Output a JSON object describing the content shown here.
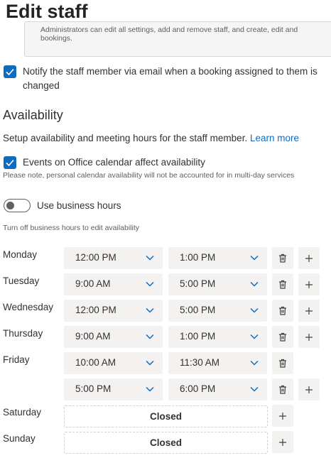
{
  "page": {
    "title": "Edit staff"
  },
  "role_info": {
    "text_line1": "Administrators can edit all settings, add and remove staff, and create, edit and",
    "text_line2": "bookings."
  },
  "notify": {
    "label_line1": "Notify the staff member via email when a booking assigned to them is",
    "label_line2": "changed",
    "checked": true
  },
  "availability": {
    "heading": "Availability",
    "description": "Setup availability and meeting hours for the staff member.",
    "learn_more": "Learn more",
    "events_label": "Events on Office calendar affect availability",
    "events_checked": true,
    "personal_note": "Please note, personal calendar availability will not be accounted for in multi-day services",
    "business_hours_label": "Use business hours",
    "business_hours_on": false,
    "business_hours_note": "Turn off business hours to edit availability"
  },
  "schedule": {
    "closed_label": "Closed",
    "monday": {
      "day": "Monday",
      "start": "12:00 PM",
      "end": "1:00 PM"
    },
    "tuesday": {
      "day": "Tuesday",
      "start": "9:00 AM",
      "end": "5:00 PM"
    },
    "wednesday": {
      "day": "Wednesday",
      "start": "12:00 PM",
      "end": "5:00 PM"
    },
    "thursday": {
      "day": "Thursday",
      "start": "9:00 AM",
      "end": "1:00 PM"
    },
    "friday": {
      "day": "Friday",
      "start": "10:00 AM",
      "end": "11:30 AM",
      "start2": "5:00 PM",
      "end2": "6:00 PM"
    },
    "saturday": {
      "day": "Saturday"
    },
    "sunday": {
      "day": "Sunday"
    }
  },
  "icons": {
    "delete": "trash-icon",
    "add": "plus-icon",
    "dropdown": "chevron-down-icon",
    "check": "checkmark-icon"
  },
  "colors": {
    "accent": "#0f6cbd",
    "field_bg": "#f3f2f1"
  }
}
